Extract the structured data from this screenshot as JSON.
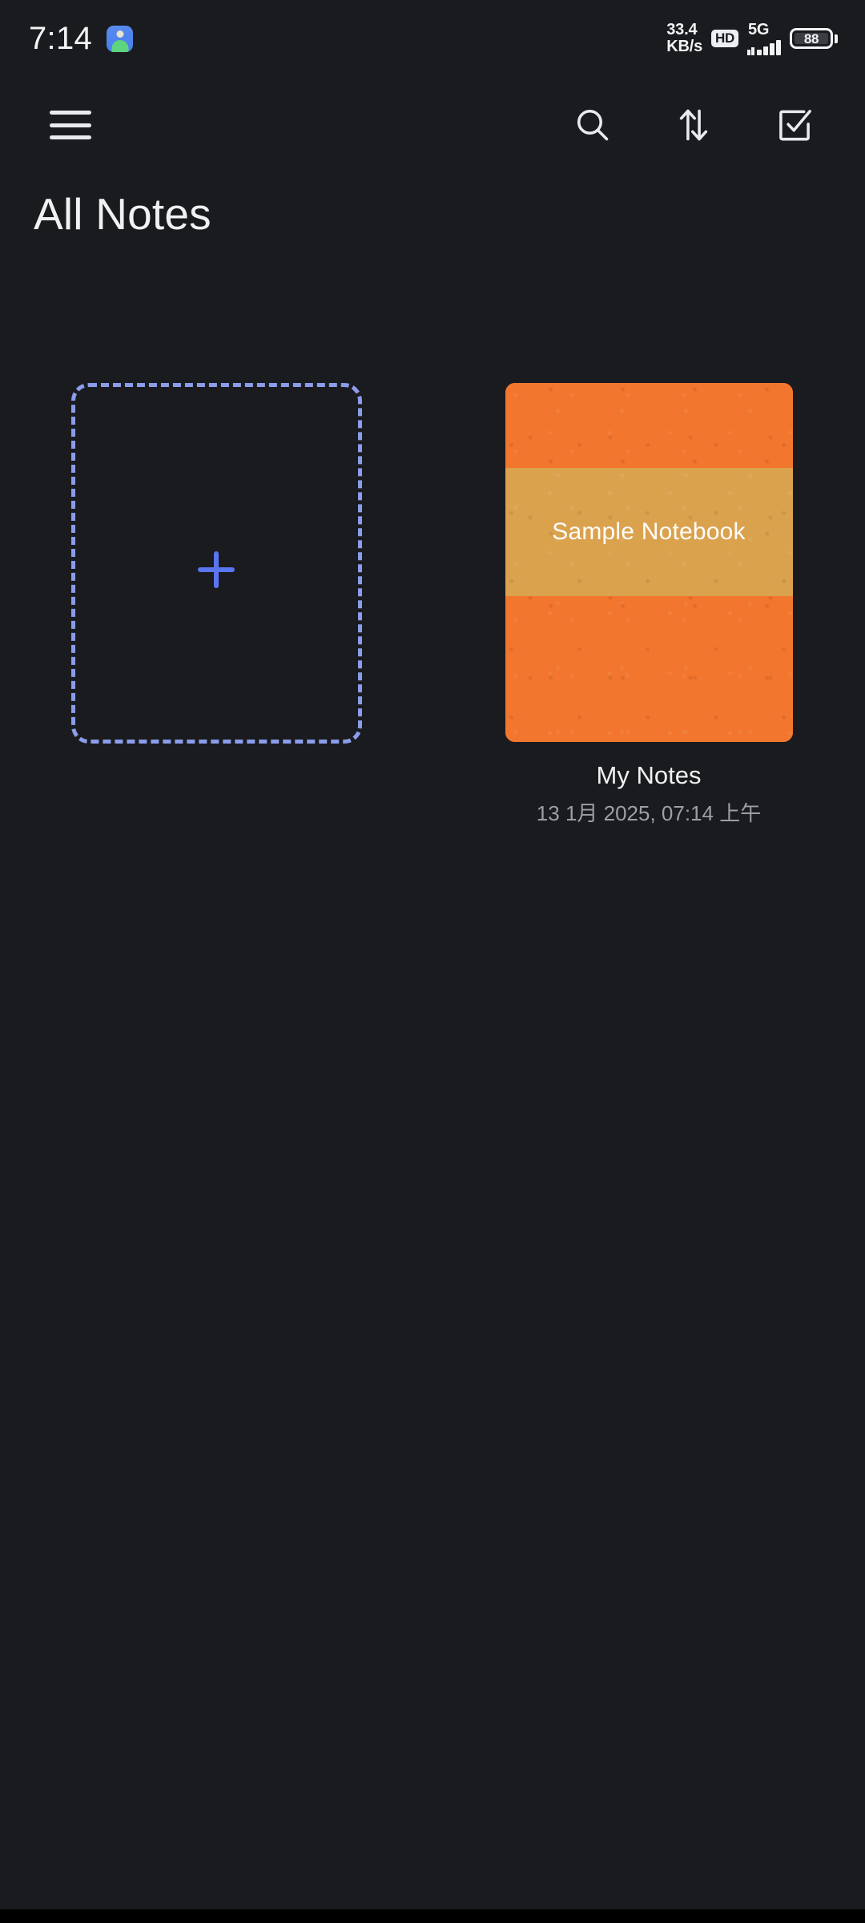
{
  "status_bar": {
    "clock": "7:14",
    "notification_icon": "android-notification-icon",
    "network_speed_value": "33.4",
    "network_speed_unit": "KB/s",
    "hd_badge": "HD",
    "network_type": "5G",
    "signal_icon": "signal-bars-icon",
    "battery_level": "88",
    "battery_icon": "battery-icon"
  },
  "app_bar": {
    "menu_icon": "hamburger-menu-icon",
    "search_icon": "search-icon",
    "sort_icon": "sort-arrows-icon",
    "select_icon": "select-checkbox-icon"
  },
  "page": {
    "title": "All Notes"
  },
  "add_tile": {
    "plus_icon": "plus-icon",
    "accent_color": "#8b9cea",
    "plus_color": "#5a75f0"
  },
  "notebooks": [
    {
      "cover_text": "Sample Notebook",
      "title": "My Notes",
      "date": "13 1月 2025, 07:14 上午",
      "cover_color": "#f2762e",
      "band_color": "#dba24e"
    }
  ],
  "theme": {
    "background": "#1a1b1f",
    "nav_bar": "#000000",
    "text_primary": "#f0f1f3",
    "text_secondary": "#9c9fa6"
  }
}
